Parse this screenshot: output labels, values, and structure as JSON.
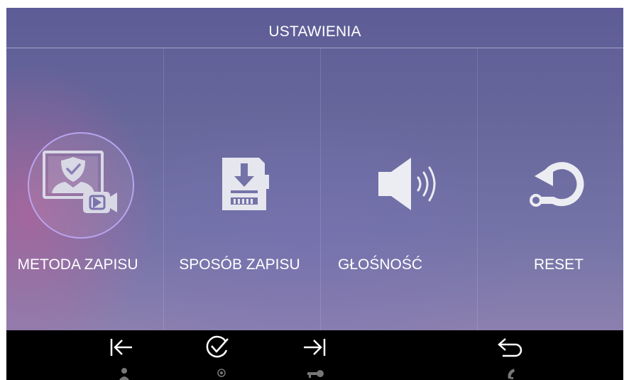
{
  "header": {
    "title": "USTAWIENIA"
  },
  "tiles": [
    {
      "label": "METODA ZAPISU",
      "icon": "record-method-icon",
      "selected": true
    },
    {
      "label": "SPOSÓB ZAPISU",
      "icon": "sd-card-download-icon",
      "selected": false
    },
    {
      "label": "GŁOŚNOŚĆ",
      "icon": "speaker-volume-icon",
      "selected": false
    },
    {
      "label": "RESET",
      "icon": "reset-icon",
      "selected": false
    }
  ],
  "footer": {
    "buttons": [
      {
        "icon": "arrow-left-bar-icon"
      },
      {
        "icon": "check-circle-icon"
      },
      {
        "icon": "arrow-right-bar-icon"
      },
      {
        "icon": "back-arrow-icon"
      }
    ],
    "hardware_hints": [
      {
        "icon": "person-icon"
      },
      {
        "icon": "monitor-dot-icon"
      },
      {
        "icon": "key-icon"
      },
      {
        "icon": "phone-handset-icon"
      }
    ]
  },
  "colors": {
    "accent_ring": "#b9a4ee",
    "footer_bg": "#000000",
    "text": "#ffffff"
  }
}
